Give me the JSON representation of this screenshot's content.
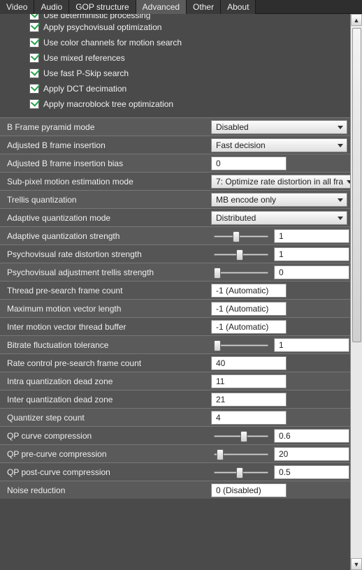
{
  "tabs": [
    "Video",
    "Audio",
    "GOP structure",
    "Advanced",
    "Other",
    "About"
  ],
  "checks": {
    "deterministic": "Use deterministic processing",
    "psyopt": "Apply psychovisual optimization",
    "colorchan": "Use color channels for motion search",
    "mixedref": "Use mixed references",
    "pskip": "Use fast P-Skip search",
    "dct": "Apply DCT decimation",
    "mbtree": "Apply macroblock tree optimization"
  },
  "rows": {
    "bpyramid": {
      "label": "B Frame pyramid mode",
      "value": "Disabled"
    },
    "adjb": {
      "label": "Adjusted B frame insertion",
      "value": "Fast decision"
    },
    "adjbbias": {
      "label": "Adjusted B frame insertion bias",
      "value": "0"
    },
    "subpix": {
      "label": "Sub-pixel motion estimation mode",
      "value": "7: Optimize rate distortion in all fra"
    },
    "trellis": {
      "label": "Trellis quantization",
      "value": "MB encode only"
    },
    "aqmode": {
      "label": "Adaptive quantization mode",
      "value": "Distributed"
    },
    "aqstr": {
      "label": "Adaptive quantization strength",
      "value": "1"
    },
    "psyrate": {
      "label": "Psychovisual rate distortion strength",
      "value": "1"
    },
    "psytrel": {
      "label": "Psychovisual adjustment trellis strength",
      "value": "0"
    },
    "threadpre": {
      "label": "Thread pre-search frame count",
      "value": "-1 (Automatic)"
    },
    "maxmv": {
      "label": "Maximum motion vector length",
      "value": "-1 (Automatic)"
    },
    "intermvbuf": {
      "label": "Inter motion vector thread buffer",
      "value": "-1 (Automatic)"
    },
    "fluct": {
      "label": "Bitrate fluctuation tolerance",
      "value": "1"
    },
    "rcpre": {
      "label": "Rate control pre-search frame count",
      "value": "40"
    },
    "intradz": {
      "label": "Intra quantization dead zone",
      "value": "11"
    },
    "interdz": {
      "label": "Inter quantization dead zone",
      "value": "21"
    },
    "qstep": {
      "label": "Quantizer step count",
      "value": "4"
    },
    "qpcurve": {
      "label": "QP curve compression",
      "value": "0.6"
    },
    "qppre": {
      "label": "QP pre-curve compression",
      "value": "20"
    },
    "qppost": {
      "label": "QP post-curve compression",
      "value": "0.5"
    },
    "noise": {
      "label": "Noise reduction",
      "value": "0 (Disabled)"
    }
  }
}
